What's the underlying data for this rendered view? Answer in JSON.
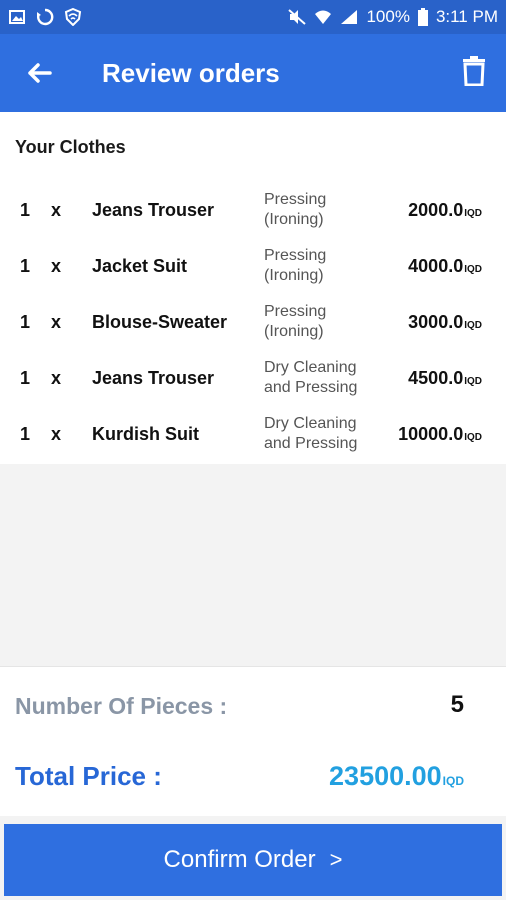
{
  "status_bar": {
    "battery": "100%",
    "time": "3:11 PM",
    "icons": [
      "image-icon",
      "sync-icon",
      "shield-icon",
      "mute-icon",
      "wifi-icon",
      "signal-icon",
      "battery-icon"
    ]
  },
  "app_bar": {
    "title": "Review orders",
    "back_icon": "arrow-left-icon",
    "delete_icon": "trash-icon"
  },
  "list": {
    "section_title": "Your Clothes",
    "items": [
      {
        "qty": "1",
        "x": "x",
        "name": "Jeans Trouser",
        "service_line1": "Pressing",
        "service_line2": "(Ironing)",
        "price": "2000.0",
        "currency": "IQD"
      },
      {
        "qty": "1",
        "x": "x",
        "name": "Jacket Suit",
        "service_line1": "Pressing",
        "service_line2": "(Ironing)",
        "price": "4000.0",
        "currency": "IQD"
      },
      {
        "qty": "1",
        "x": "x",
        "name": "Blouse-Sweater",
        "service_line1": "Pressing",
        "service_line2": "(Ironing)",
        "price": "3000.0",
        "currency": "IQD"
      },
      {
        "qty": "1",
        "x": "x",
        "name": "Jeans Trouser",
        "service_line1": "Dry Cleaning",
        "service_line2": "and Pressing",
        "price": "4500.0",
        "currency": "IQD"
      },
      {
        "qty": "1",
        "x": "x",
        "name": "Kurdish Suit",
        "service_line1": "Dry Cleaning",
        "service_line2": "and Pressing",
        "price": "10000.0",
        "currency": "IQD"
      }
    ]
  },
  "summary": {
    "pieces_label": "Number Of Pieces :",
    "pieces_value": "5",
    "total_label": "Total Price :",
    "total_value": "23500.00",
    "total_currency": "IQD"
  },
  "confirm": {
    "label": "Confirm Order",
    "arrow": ">"
  },
  "colors": {
    "app_bar": "#2f6fe0",
    "status_bar": "#2962c9",
    "total_label": "#2767d6",
    "total_value": "#22a0e0",
    "muted_label": "#8a96a6"
  }
}
